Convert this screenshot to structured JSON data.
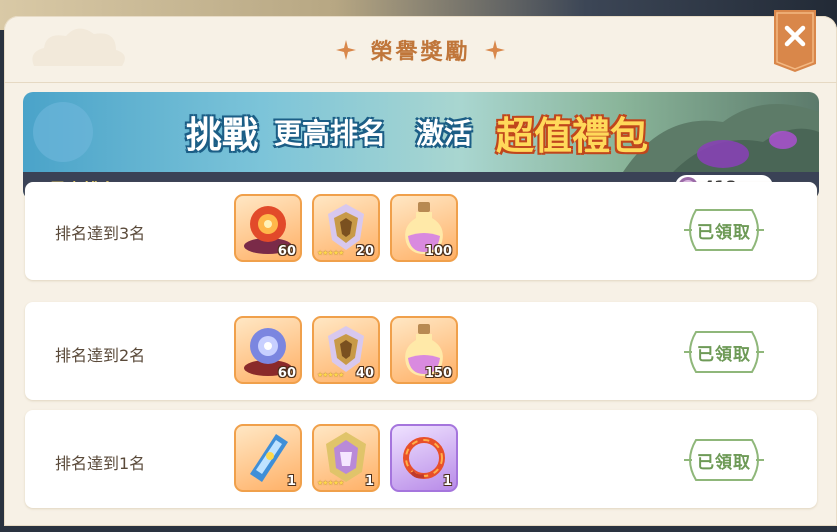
{
  "dialog": {
    "title": "榮譽獎勵"
  },
  "banner": {
    "text_challenge": "挑戰",
    "text_higher_rank": "更高排名",
    "text_activate": "激活",
    "text_value_pack": "超值禮包"
  },
  "rank_bar": {
    "best_rank_label": "最高排名：1",
    "currency_value": "418"
  },
  "rewards": [
    {
      "label": "排名達到3名",
      "status": "已領取",
      "items": [
        {
          "icon": "crystal-ball-icon",
          "qty": "60"
        },
        {
          "icon": "shield-crest-icon",
          "qty": "20",
          "stars": "★★★★★"
        },
        {
          "icon": "potion-bottle-icon",
          "qty": "100"
        }
      ]
    },
    {
      "label": "排名達到2名",
      "status": "已領取",
      "items": [
        {
          "icon": "crystal-ball-icon",
          "qty": "60"
        },
        {
          "icon": "shield-crest-icon",
          "qty": "40",
          "stars": "★★★★★"
        },
        {
          "icon": "potion-bottle-icon",
          "qty": "150"
        }
      ]
    },
    {
      "label": "排名達到1名",
      "status": "已領取",
      "items": [
        {
          "icon": "scroll-icon",
          "qty": "1"
        },
        {
          "icon": "crest-frame-icon",
          "qty": "1",
          "stars": "★★★★★"
        },
        {
          "icon": "flame-ring-icon",
          "qty": "1"
        }
      ]
    }
  ],
  "colors": {
    "title": "#c0763a",
    "rank_label": "#ffe16b",
    "claimed": "#6e9a57",
    "close_button": "#d9874a"
  }
}
